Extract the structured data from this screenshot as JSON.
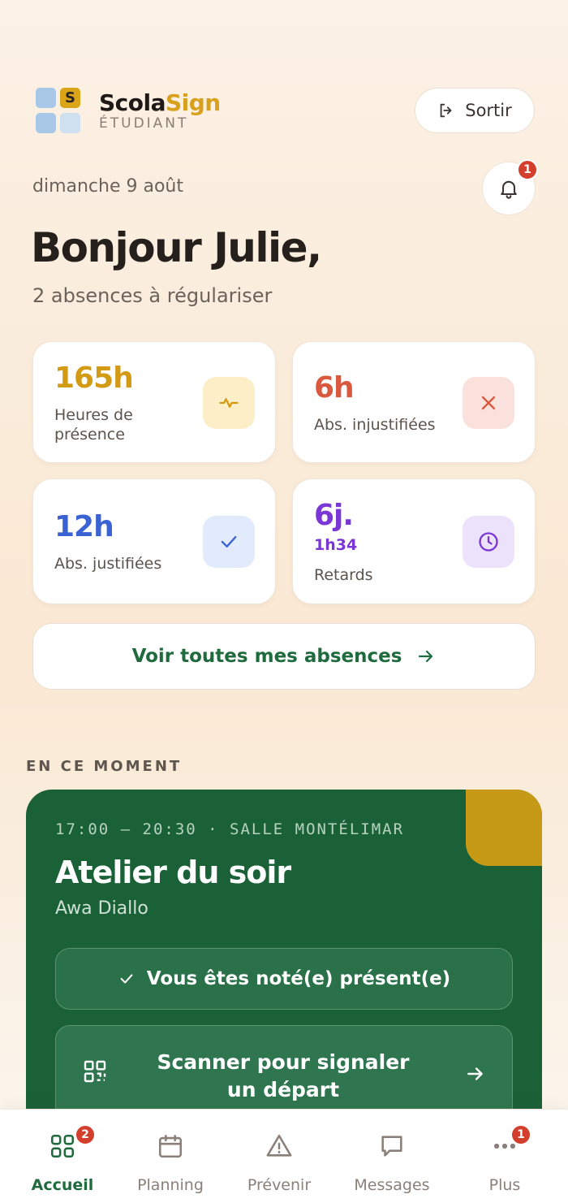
{
  "header": {
    "logo_letter": "S",
    "brand_part1": "Scola",
    "brand_part2": "Sign",
    "brand_sub": "ÉTUDIANT",
    "logout_label": "Sortir",
    "notification_count": "1"
  },
  "greeting": {
    "date": "dimanche 9 août",
    "title": "Bonjour Julie,",
    "subtitle": "2 absences à régulariser"
  },
  "stats": {
    "presence": {
      "value": "165h",
      "label_line1": "Heures de",
      "label_line2": "présence",
      "color": "#d39a14",
      "icon": "activity-icon"
    },
    "unjustified": {
      "value": "6h",
      "label": "Abs. injustifiées",
      "color": "#d9583e",
      "icon": "close-icon"
    },
    "justified": {
      "value": "12h",
      "label": "Abs. justifiées",
      "color": "#3b62d2",
      "icon": "check-icon"
    },
    "delays": {
      "value": "6j.",
      "sub": "1h34",
      "label": "Retards",
      "color": "#7b37d6",
      "icon": "clock-icon"
    }
  },
  "view_all": {
    "label": "Voir toutes mes absences"
  },
  "current": {
    "section_title": "EN CE MOMENT",
    "meta": "17:00 — 20:30 · SALLE MONTÉLIMAR",
    "title": "Atelier du soir",
    "teacher": "Awa Diallo",
    "present_label": "Vous êtes noté(e) présent(e)",
    "scan_label": "Scanner pour signaler un départ"
  },
  "nav": {
    "items": [
      {
        "label": "Accueil",
        "icon": "grid-icon",
        "active": true,
        "badge": "2"
      },
      {
        "label": "Planning",
        "icon": "calendar-icon"
      },
      {
        "label": "Prévenir",
        "icon": "warning-icon"
      },
      {
        "label": "Messages",
        "icon": "message-icon"
      },
      {
        "label": "Plus",
        "icon": "more-icon",
        "badge": "1"
      }
    ]
  }
}
